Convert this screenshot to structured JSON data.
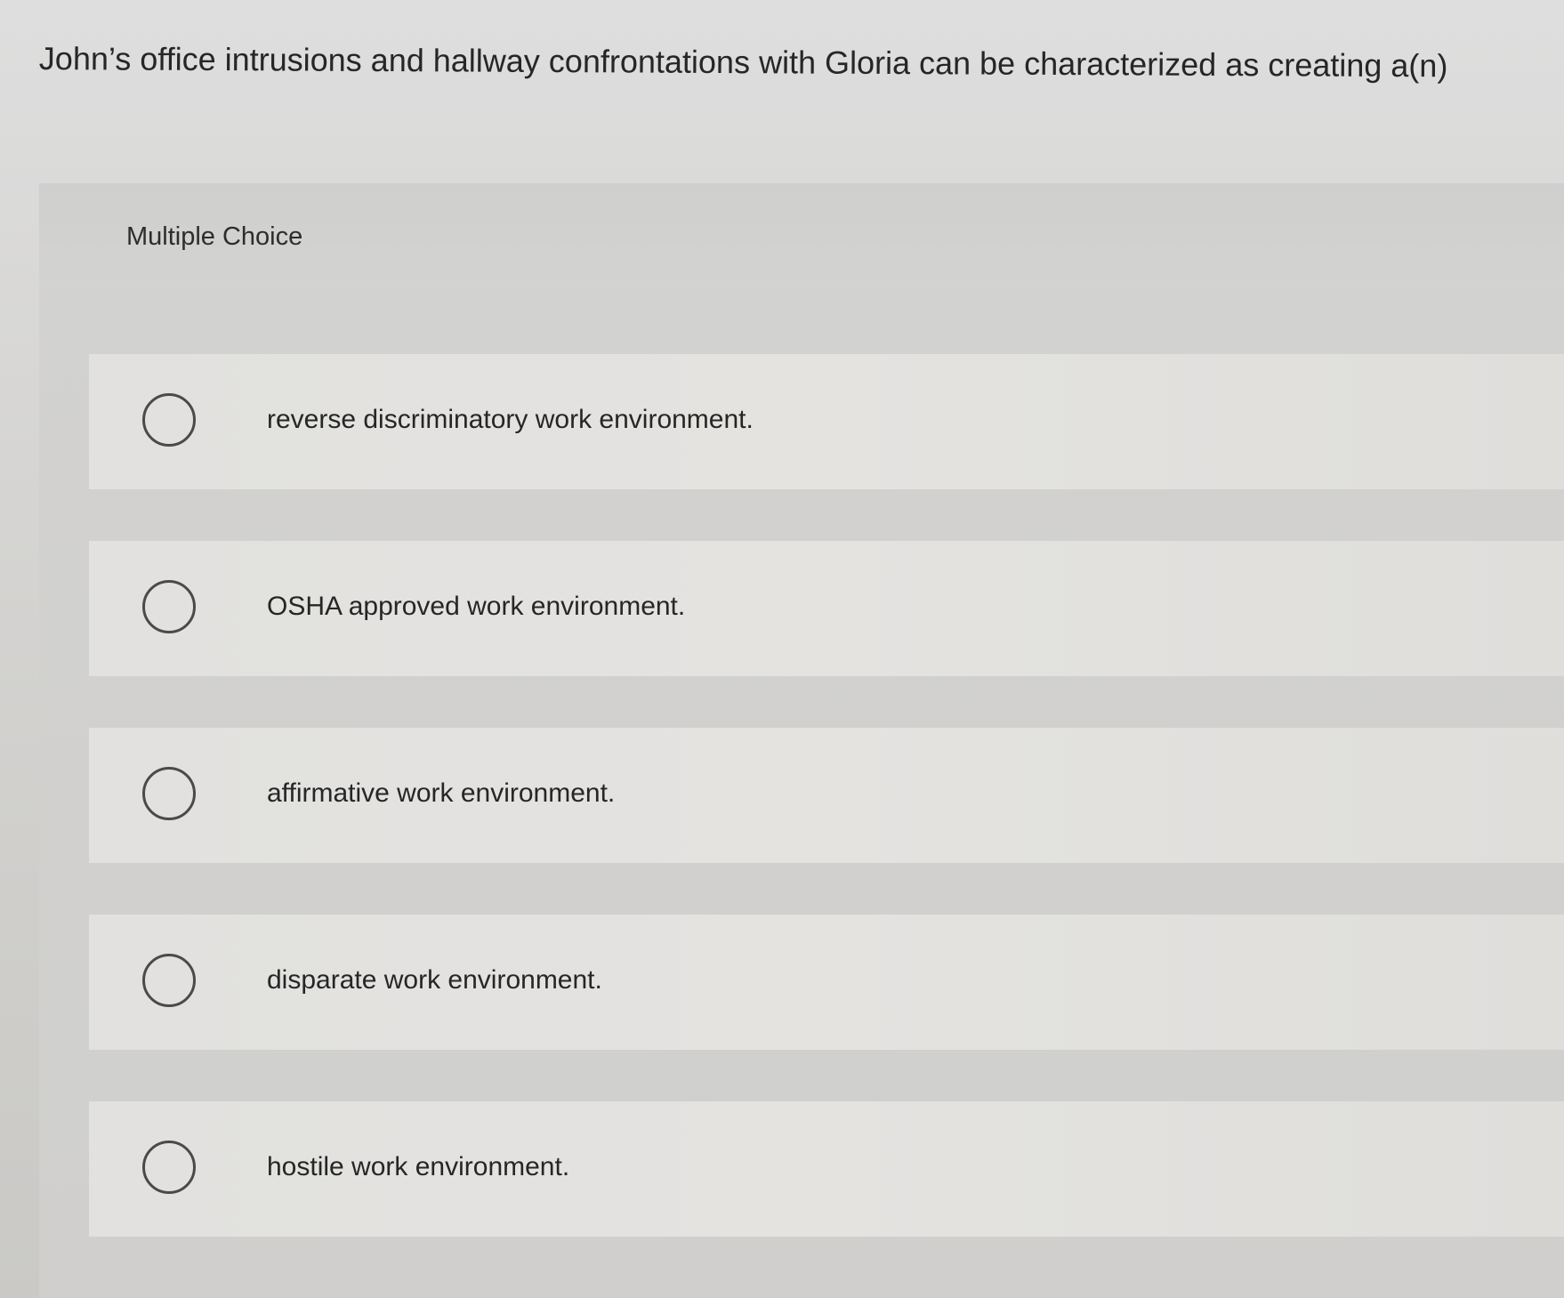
{
  "question": {
    "text": "John’s office intrusions and hallway confrontations with Gloria can be characterized as creating a(n)"
  },
  "multiple_choice": {
    "label": "Multiple Choice",
    "selected_index": null,
    "options": [
      {
        "label": "reverse discriminatory work environment."
      },
      {
        "label": "OSHA approved work environment."
      },
      {
        "label": "affirmative work environment."
      },
      {
        "label": "disparate work environment."
      },
      {
        "label": "hostile work environment."
      }
    ]
  },
  "colors": {
    "text": "#262626",
    "radio_border": "#4a4a4a",
    "option_background": "#e2e1df",
    "panel_background": "#d1d1cf"
  }
}
